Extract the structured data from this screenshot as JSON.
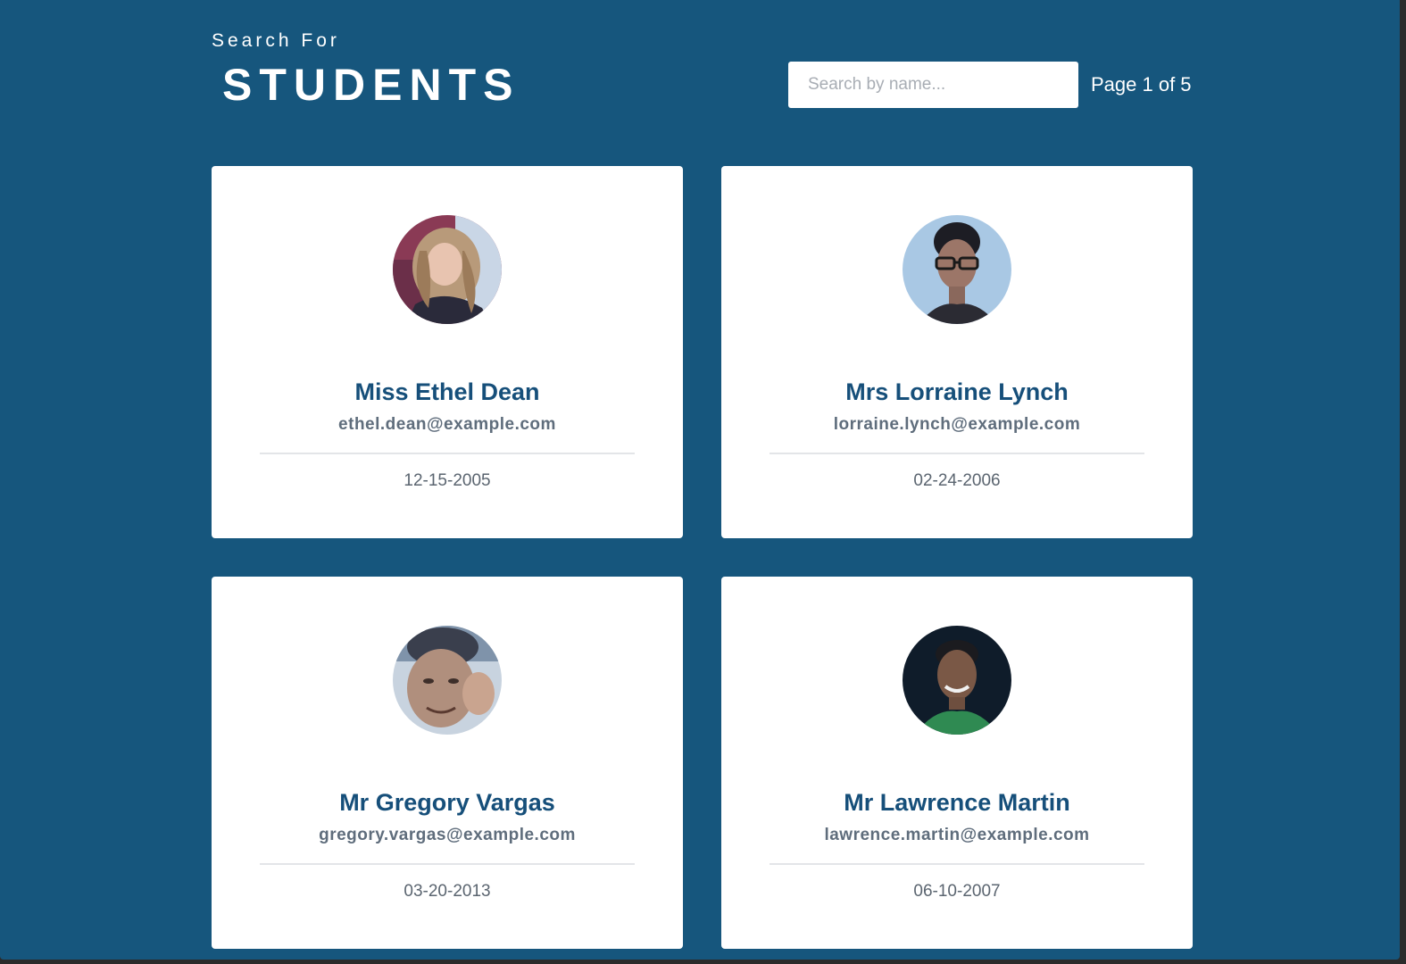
{
  "header": {
    "kicker": "Search For",
    "title": "STUDENTS"
  },
  "search": {
    "placeholder": "Search by name...",
    "value": ""
  },
  "pagination": {
    "label": "Page 1 of 5"
  },
  "students": [
    {
      "name": "Miss Ethel Dean",
      "email": "ethel.dean@example.com",
      "dob": "12-15-2005",
      "avatar": "woman-curly-hair-photo"
    },
    {
      "name": "Mrs Lorraine Lynch",
      "email": "lorraine.lynch@example.com",
      "dob": "02-24-2006",
      "avatar": "woman-glasses-photo"
    },
    {
      "name": "Mr Gregory Vargas",
      "email": "gregory.vargas@example.com",
      "dob": "03-20-2013",
      "avatar": "man-waving-photo"
    },
    {
      "name": "Mr Lawrence Martin",
      "email": "lawrence.martin@example.com",
      "dob": "06-10-2007",
      "avatar": "man-green-shirt-photo"
    }
  ],
  "colors": {
    "background": "#16567d",
    "card": "#ffffff",
    "name_text": "#164f7a",
    "email_text": "#5f6d7c",
    "divider": "#e3e5e8"
  }
}
